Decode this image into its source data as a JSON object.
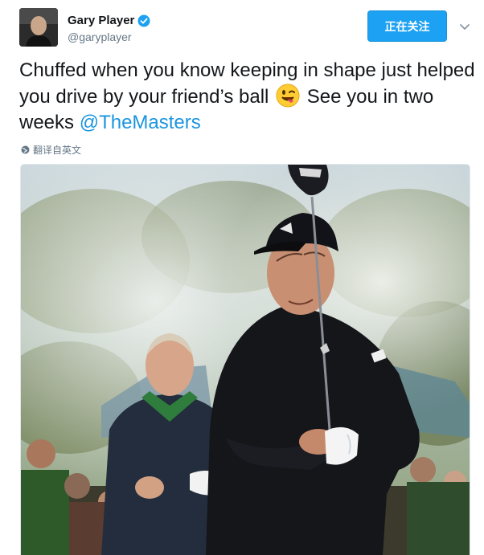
{
  "user": {
    "display_name": "Gary Player",
    "handle": "@garyplayer",
    "verified": true
  },
  "follow_button": {
    "label": "正在关注"
  },
  "tweet": {
    "text_part1": "Chuffed when you know keeping in shape just helped you drive by your friend’s ball ",
    "emoji": "winking-face-with-tongue",
    "text_part2": " See you in two weeks ",
    "mention": "@TheMasters"
  },
  "translate": {
    "label": "翻译自英文"
  },
  "media": {
    "alt": "Gary Player swinging a driver with Jack Nicklaus watching"
  },
  "colors": {
    "brand_blue": "#1da1f2",
    "link_blue": "#1b95e0",
    "muted_gray": "#657786"
  }
}
